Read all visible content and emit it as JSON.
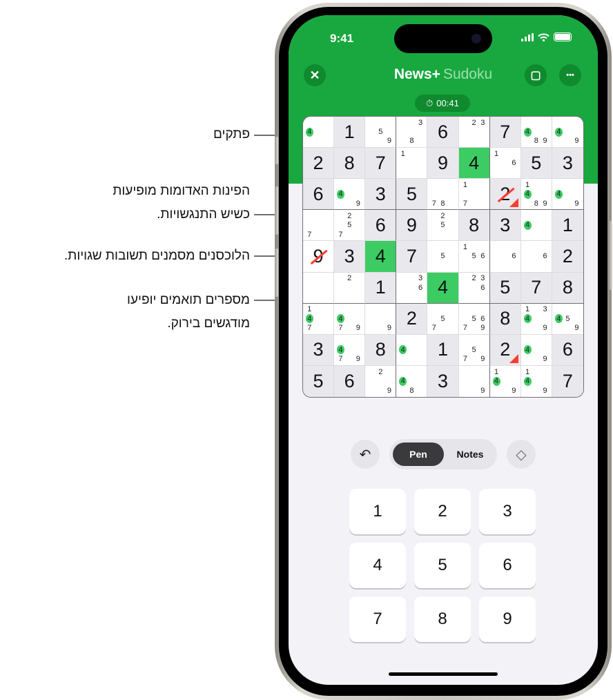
{
  "callouts": [
    {
      "text": "פתקים"
    },
    {
      "line1": "הפינות האדומות מופיעות",
      "line2": "כשיש התנגשויות."
    },
    {
      "text": "הלוכסנים מסמנים תשובות שגויות."
    },
    {
      "line1": "מספרים תואמים יופיעו",
      "line2": "מודגשים בירוק."
    }
  ],
  "status_bar": {
    "time": "9:41",
    "icons": [
      "signal-icon",
      "wifi-icon",
      "battery-icon"
    ]
  },
  "header": {
    "close_icon": "✕",
    "brand": "News+",
    "apple_glyph": "",
    "subtitle": "Sudoku",
    "check_icon": "▢",
    "more_icon": "•••",
    "timer_icon": "⏱",
    "timer": "00:41"
  },
  "accent_color": "#18a83f",
  "highlight_color": "#3ccc63",
  "error_color": "#ff3b30",
  "grid": [
    [
      {
        "n": [
          4
        ],
        "g": [
          4
        ]
      },
      {
        "v": "1",
        "s": 1
      },
      {
        "n": [
          5,
          9
        ]
      },
      {
        "n": [
          3,
          8
        ]
      },
      {
        "v": "6",
        "s": 1
      },
      {
        "n": [
          2,
          3
        ]
      },
      {
        "v": "7",
        "s": 1
      },
      {
        "n": [
          4,
          8,
          9
        ],
        "g": [
          4
        ]
      },
      {
        "n": [
          4,
          9
        ],
        "g": [
          4
        ]
      }
    ],
    [
      {
        "v": "2",
        "s": 1
      },
      {
        "v": "8",
        "s": 1
      },
      {
        "v": "7",
        "s": 1
      },
      {
        "n": [
          1
        ]
      },
      {
        "v": "9",
        "s": 1
      },
      {
        "v": "4",
        "h": 1
      },
      {
        "n": [
          1,
          6
        ]
      },
      {
        "v": "5",
        "s": 1
      },
      {
        "v": "3",
        "s": 1
      }
    ],
    [
      {
        "v": "6",
        "s": 1
      },
      {
        "n": [
          4,
          9
        ],
        "g": [
          4
        ]
      },
      {
        "v": "3",
        "s": 1
      },
      {
        "v": "5",
        "s": 1
      },
      {
        "n": [
          7,
          8
        ]
      },
      {
        "n": [
          1,
          7
        ]
      },
      {
        "v": "2",
        "s": 1,
        "wrong": 1,
        "conflict": 1
      },
      {
        "n": [
          1,
          4,
          8,
          9
        ],
        "g": [
          4
        ]
      },
      {
        "n": [
          4,
          9
        ],
        "g": [
          4
        ]
      }
    ],
    [
      {
        "n": [
          7
        ]
      },
      {
        "n": [
          2,
          5,
          7
        ]
      },
      {
        "v": "6",
        "s": 1
      },
      {
        "v": "9",
        "s": 1
      },
      {
        "n": [
          2,
          5
        ]
      },
      {
        "v": "8",
        "s": 1
      },
      {
        "v": "3",
        "s": 1
      },
      {
        "n": [
          4
        ],
        "g": [
          4
        ]
      },
      {
        "v": "1",
        "s": 1
      }
    ],
    [
      {
        "v": "9",
        "wrong": 1
      },
      {
        "v": "3",
        "s": 1
      },
      {
        "v": "4",
        "h": 1
      },
      {
        "v": "7",
        "s": 1
      },
      {
        "n": [
          5
        ]
      },
      {
        "n": [
          1,
          5,
          6
        ]
      },
      {
        "n": [
          6
        ]
      },
      {
        "n": [
          6
        ]
      },
      {
        "v": "2",
        "s": 1
      }
    ],
    [
      {
        "n": []
      },
      {
        "n": [
          2
        ]
      },
      {
        "v": "1",
        "s": 1
      },
      {
        "n": [
          3,
          6
        ]
      },
      {
        "v": "4",
        "h": 1
      },
      {
        "n": [
          2,
          3,
          6
        ]
      },
      {
        "v": "5",
        "s": 1
      },
      {
        "v": "7",
        "s": 1
      },
      {
        "v": "8",
        "s": 1
      }
    ],
    [
      {
        "n": [
          1,
          4,
          7
        ],
        "g": [
          4
        ]
      },
      {
        "n": [
          4,
          7,
          9
        ],
        "g": [
          4
        ]
      },
      {
        "n": [
          9
        ]
      },
      {
        "v": "2",
        "s": 1
      },
      {
        "n": [
          5,
          7
        ]
      },
      {
        "n": [
          5,
          6,
          7,
          9
        ]
      },
      {
        "v": "8",
        "s": 1
      },
      {
        "n": [
          1,
          3,
          4,
          9
        ],
        "g": [
          4
        ]
      },
      {
        "n": [
          4,
          5,
          9
        ],
        "g": [
          4
        ]
      }
    ],
    [
      {
        "v": "3",
        "s": 1
      },
      {
        "n": [
          4,
          7,
          9
        ],
        "g": [
          4
        ]
      },
      {
        "v": "8",
        "s": 1
      },
      {
        "n": [
          4
        ],
        "g": [
          4
        ]
      },
      {
        "v": "1",
        "s": 1
      },
      {
        "n": [
          5,
          7,
          9
        ]
      },
      {
        "v": "2",
        "s": 1,
        "conflict": 1
      },
      {
        "n": [
          4,
          9
        ],
        "g": [
          4
        ]
      },
      {
        "v": "6",
        "s": 1
      }
    ],
    [
      {
        "v": "5",
        "s": 1
      },
      {
        "v": "6",
        "s": 1
      },
      {
        "n": [
          2,
          9
        ]
      },
      {
        "n": [
          4,
          8
        ],
        "g": [
          4
        ]
      },
      {
        "v": "3",
        "s": 1
      },
      {
        "n": [
          9
        ]
      },
      {
        "n": [
          1,
          4,
          9
        ],
        "g": [
          4
        ]
      },
      {
        "n": [
          1,
          4,
          9
        ],
        "g": [
          4
        ]
      },
      {
        "v": "7",
        "s": 1
      }
    ]
  ],
  "controls": {
    "undo_icon": "↶",
    "pen_label": "Pen",
    "notes_label": "Notes",
    "erase_icon": "◇"
  },
  "keypad": [
    "1",
    "2",
    "3",
    "4",
    "5",
    "6",
    "7",
    "8",
    "9"
  ]
}
